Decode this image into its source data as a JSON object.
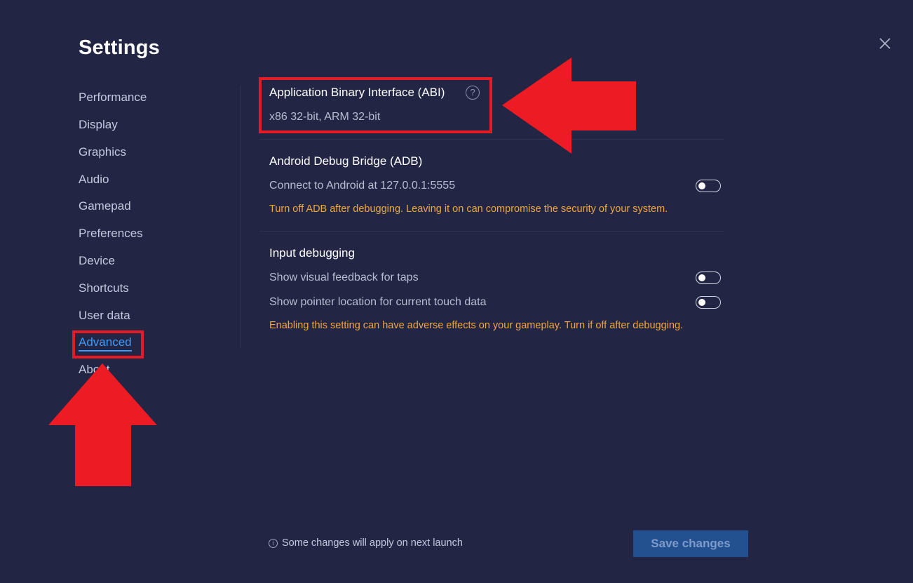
{
  "header": {
    "title": "Settings"
  },
  "sidebar": {
    "items": [
      {
        "label": "Performance"
      },
      {
        "label": "Display"
      },
      {
        "label": "Graphics"
      },
      {
        "label": "Audio"
      },
      {
        "label": "Gamepad"
      },
      {
        "label": "Preferences"
      },
      {
        "label": "Device"
      },
      {
        "label": "Shortcuts"
      },
      {
        "label": "User data"
      },
      {
        "label": "Advanced"
      },
      {
        "label": "About"
      }
    ],
    "active": "Advanced"
  },
  "abi": {
    "title": "Application Binary Interface (ABI)",
    "help_icon_glyph": "?",
    "value": "x86 32-bit, ARM 32-bit"
  },
  "adb": {
    "title": "Android Debug Bridge (ADB)",
    "connect_label": "Connect to Android at 127.0.0.1:5555",
    "connect_enabled": false,
    "warning": "Turn off ADB after debugging. Leaving it on can compromise the security of your system."
  },
  "input_debugging": {
    "title": "Input debugging",
    "taps_label": "Show visual feedback for taps",
    "taps_enabled": false,
    "pointer_label": "Show pointer location for current touch data",
    "pointer_enabled": false,
    "warning": "Enabling this setting can have adverse effects on your gameplay. Turn if off after debugging."
  },
  "footer": {
    "info_glyph": "i",
    "note": "Some changes will apply on next launch",
    "save_label": "Save changes"
  },
  "colors": {
    "background": "#222543",
    "accent": "#3d9bff",
    "warning": "#f2a73b",
    "annotation_red": "#e31c25",
    "save_button": "#23508f"
  },
  "icons": {
    "close": "close-icon",
    "help": "question-circle-icon",
    "info": "info-circle-icon"
  }
}
